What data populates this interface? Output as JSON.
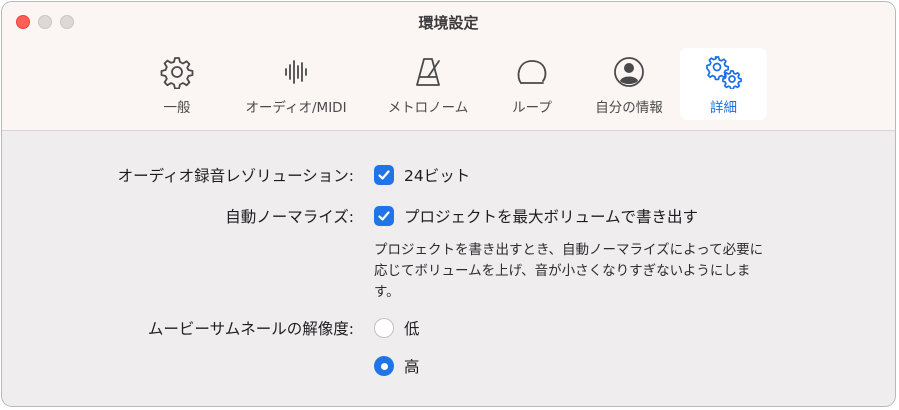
{
  "window": {
    "title": "環境設定"
  },
  "toolbar": {
    "tabs": [
      {
        "label": "一般",
        "icon": "gear-icon"
      },
      {
        "label": "オーディオ/MIDI",
        "icon": "waveform-icon"
      },
      {
        "label": "メトロノーム",
        "icon": "metronome-icon"
      },
      {
        "label": "ループ",
        "icon": "loop-icon"
      },
      {
        "label": "自分の情報",
        "icon": "person-icon"
      },
      {
        "label": "詳細",
        "icon": "gears-icon",
        "selected": true
      }
    ]
  },
  "settings": {
    "audio_resolution": {
      "label": "オーディオ録音レゾリューション:",
      "option": "24ビット",
      "checked": true
    },
    "auto_normalize": {
      "label": "自動ノーマライズ:",
      "option": "プロジェクトを最大ボリュームで書き出す",
      "checked": true,
      "description_lines": [
        "プロジェクトを書き出すとき、自動ノーマライズによって必要に",
        "応じてボリュームを上げ、音が小さくなりすぎないようにしま",
        "す。"
      ]
    },
    "thumbnail_resolution": {
      "label": "ムービーサムネールの解像度:",
      "options": [
        "低",
        "高"
      ],
      "selected": "高"
    }
  },
  "colors": {
    "accent": "#1f75e8",
    "close": "#ff5f57"
  }
}
